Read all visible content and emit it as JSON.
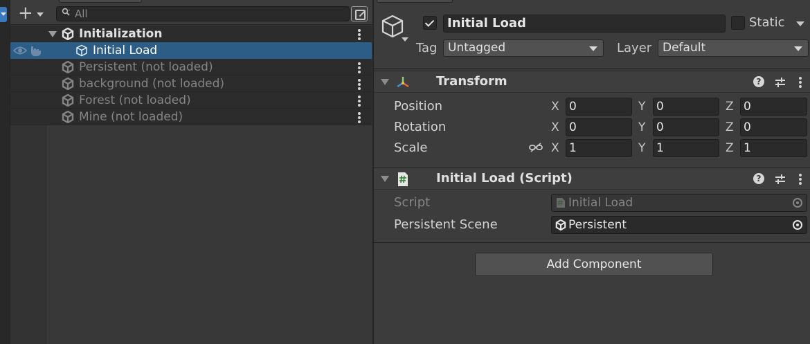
{
  "hierarchy": {
    "search_placeholder": "All",
    "items": [
      {
        "label": "Initialization",
        "type": "scene",
        "state": "loaded"
      },
      {
        "label": "Initial Load",
        "type": "gameobject",
        "state": "selected"
      },
      {
        "label": "Persistent (not loaded)",
        "type": "scene",
        "state": "unloaded"
      },
      {
        "label": "background (not loaded)",
        "type": "scene",
        "state": "unloaded"
      },
      {
        "label": "Forest (not loaded)",
        "type": "scene",
        "state": "unloaded"
      },
      {
        "label": "Mine (not loaded)",
        "type": "scene",
        "state": "unloaded"
      }
    ]
  },
  "inspector": {
    "object_name": "Initial Load",
    "active": true,
    "static_label": "Static",
    "static_checked": false,
    "tag_label": "Tag",
    "tag_value": "Untagged",
    "layer_label": "Layer",
    "layer_value": "Default",
    "transform": {
      "title": "Transform",
      "rows": [
        {
          "label": "Position",
          "x": "0",
          "y": "0",
          "z": "0"
        },
        {
          "label": "Rotation",
          "x": "0",
          "y": "0",
          "z": "0"
        },
        {
          "label": "Scale",
          "x": "1",
          "y": "1",
          "z": "1"
        }
      ],
      "axes": {
        "x": "X",
        "y": "Y",
        "z": "Z"
      }
    },
    "script_component": {
      "title": "Initial Load (Script)",
      "script_label": "Script",
      "script_value": "Initial Load",
      "scene_label": "Persistent Scene",
      "scene_value": "Persistent"
    },
    "add_component_label": "Add Component"
  },
  "colors": {
    "selection": "#2c5d87",
    "panel": "#383838",
    "inspector": "#3c3c3c",
    "field": "#2a2a2a"
  },
  "icons": {
    "toolbar_add": "plus-icon",
    "search": "search-icon",
    "scene": "unity-logo-icon",
    "gameobject": "cube-icon",
    "visibility": "eye-icon",
    "pickable": "hand-icon",
    "transform": "transform-gizmo-icon",
    "script": "csharp-script-icon",
    "help": "help-icon",
    "presets": "presets-icon",
    "scale_link": "unlinked-chain-icon",
    "object_picker": "object-picker-icon"
  }
}
